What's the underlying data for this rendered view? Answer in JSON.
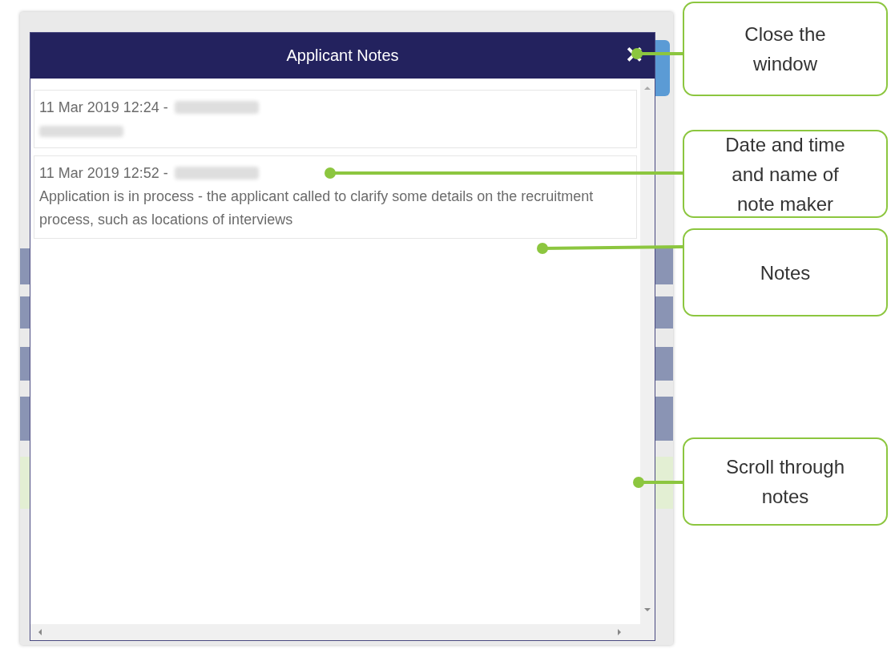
{
  "dialog": {
    "title": "Applicant Notes",
    "close_label": "✕"
  },
  "notes": [
    {
      "timestamp": "11 Mar 2019 12:24 -"
    },
    {
      "timestamp": "11 Mar 2019 12:52 -",
      "body": "Application is in process - the applicant called to clarify some details on the recruitment process, such as locations of interviews"
    }
  ],
  "callouts": [
    {
      "text": "Close the window"
    },
    {
      "text": "Date and time and name of note maker"
    },
    {
      "text": "Notes"
    },
    {
      "text": "Scroll through notes"
    }
  ]
}
